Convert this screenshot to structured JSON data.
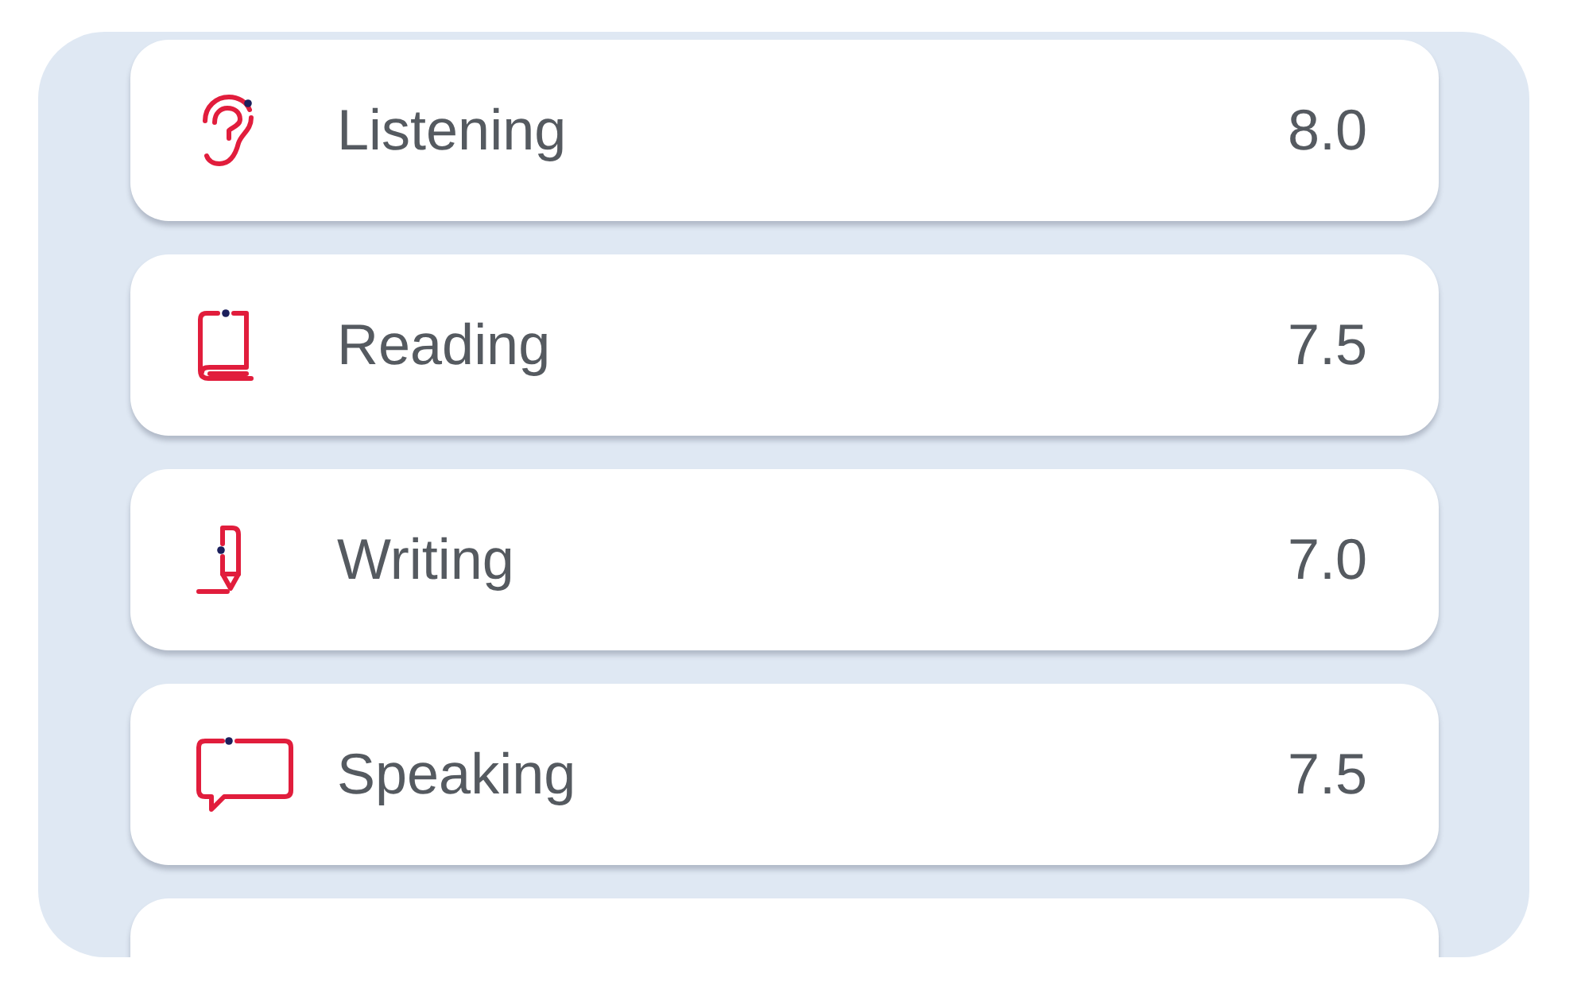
{
  "scores": [
    {
      "kind": "score",
      "skill": "Listening",
      "score": "8.0"
    },
    {
      "kind": "score",
      "skill": "Reading",
      "score": "7.5"
    },
    {
      "kind": "score",
      "skill": "Writing",
      "score": "7.0"
    },
    {
      "kind": "score",
      "skill": "Speaking",
      "score": "7.5"
    },
    {
      "kind": "blank"
    }
  ]
}
